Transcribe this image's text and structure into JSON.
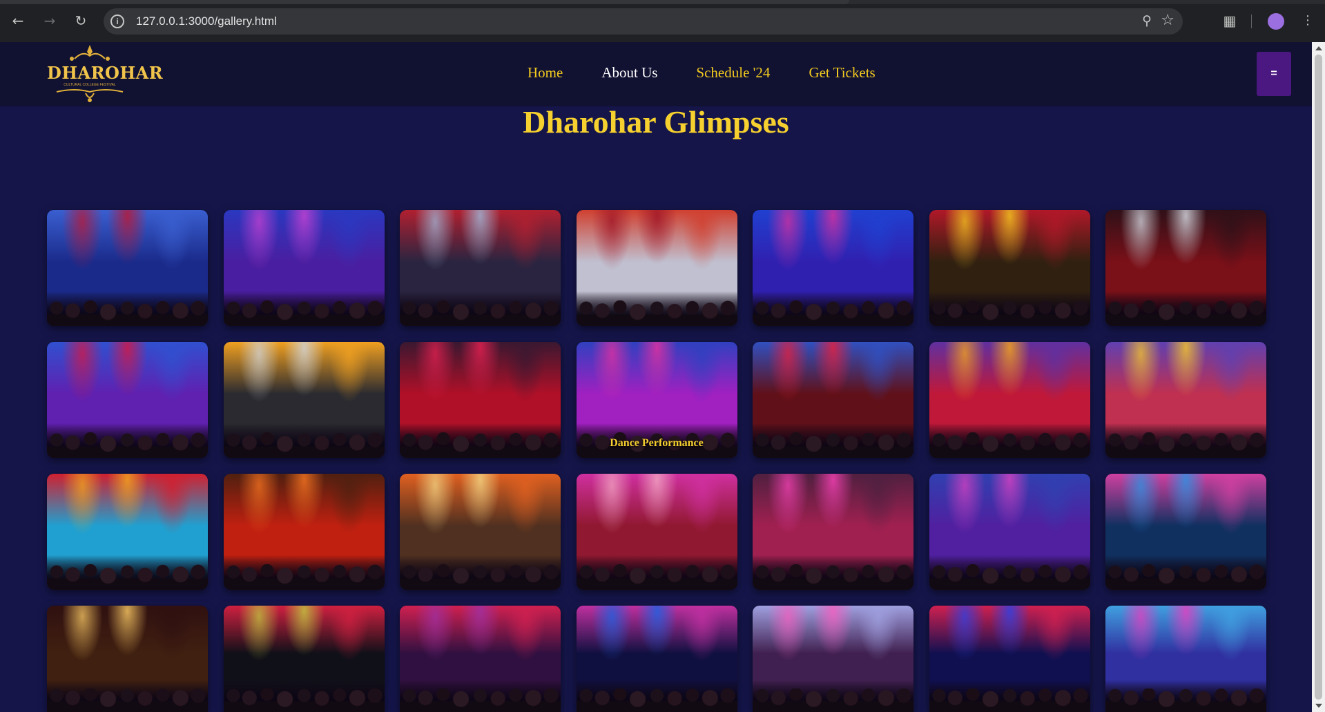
{
  "browser": {
    "url": "127.0.0.1:3000/gallery.html",
    "icons": [
      "back-arrow-icon",
      "forward-arrow-icon",
      "reload-icon",
      "site-info-icon",
      "zoom-icon",
      "bookmark-star-icon",
      "extensions-icon",
      "profile-avatar-icon",
      "kebab-menu-icon"
    ]
  },
  "header": {
    "logo_text": "DHAROHAR",
    "logo_sub": "CULTURAL COLLEGE FESTIVAL",
    "nav": [
      {
        "label": "Home"
      },
      {
        "label": "About Us"
      },
      {
        "label": "Schedule '24"
      },
      {
        "label": "Get Tickets"
      }
    ],
    "active_nav": "About Us",
    "menu_label": "="
  },
  "page": {
    "title": "Dharohar Glimpses"
  },
  "gallery": {
    "hover_caption": "Dance Performance",
    "hover_index": 10,
    "photos": [
      {
        "palette": [
          "#1a2a8a",
          "#b51a3a",
          "#3a5fd0"
        ]
      },
      {
        "palette": [
          "#4a1ea0",
          "#c040d0",
          "#2a38c0"
        ]
      },
      {
        "palette": [
          "#2a2440",
          "#9fb0d0",
          "#b02030"
        ]
      },
      {
        "palette": [
          "#c0c0d0",
          "#a01828",
          "#d04030"
        ]
      },
      {
        "palette": [
          "#3020b0",
          "#d030a0",
          "#2040d0"
        ]
      },
      {
        "palette": [
          "#302010",
          "#f0c020",
          "#b01828"
        ]
      },
      {
        "palette": [
          "#7a1018",
          "#d0d0d8",
          "#301018"
        ]
      },
      {
        "palette": [
          "#6020b0",
          "#d01848",
          "#3050d0"
        ]
      },
      {
        "palette": [
          "#2a2a30",
          "#d0d0d0",
          "#f0a020"
        ]
      },
      {
        "palette": [
          "#b01028",
          "#e02050",
          "#3a1830"
        ]
      },
      {
        "palette": [
          "#a020c0",
          "#e030a0",
          "#3040c0"
        ]
      },
      {
        "palette": [
          "#601018",
          "#e02040",
          "#3050c0"
        ]
      },
      {
        "palette": [
          "#c01838",
          "#f0a020",
          "#6030a0"
        ]
      },
      {
        "palette": [
          "#c03050",
          "#f0c030",
          "#6040b0"
        ]
      },
      {
        "palette": [
          "#20a0d0",
          "#f0a020",
          "#d02030"
        ]
      },
      {
        "palette": [
          "#c02010",
          "#f07020",
          "#502010"
        ]
      },
      {
        "palette": [
          "#503020",
          "#f0d080",
          "#e06020"
        ]
      },
      {
        "palette": [
          "#901830",
          "#f0a0c0",
          "#d030a0"
        ]
      },
      {
        "palette": [
          "#a02050",
          "#f040b0",
          "#502040"
        ]
      },
      {
        "palette": [
          "#5020a0",
          "#d040c0",
          "#3040b0"
        ]
      },
      {
        "palette": [
          "#103060",
          "#3090e0",
          "#d040a0"
        ]
      },
      {
        "palette": [
          "#402010",
          "#f0c060",
          "#301010"
        ]
      },
      {
        "palette": [
          "#101018",
          "#c0c040",
          "#d02040"
        ]
      },
      {
        "palette": [
          "#301040",
          "#a030a0",
          "#d02050"
        ]
      },
      {
        "palette": [
          "#101040",
          "#2060e0",
          "#c030a0"
        ]
      },
      {
        "palette": [
          "#402050",
          "#f060c0",
          "#a0a0e0"
        ]
      },
      {
        "palette": [
          "#101050",
          "#3040e0",
          "#d02050"
        ]
      },
      {
        "palette": [
          "#3030a0",
          "#e040c0",
          "#40a0e0"
        ]
      }
    ]
  }
}
